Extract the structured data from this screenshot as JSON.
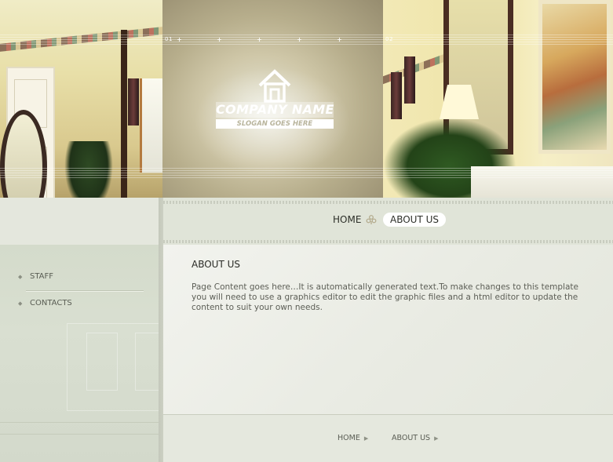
{
  "header": {
    "company_name": "COMPANY NAME",
    "slogan": "SLOGAN GOES HERE",
    "photo_labels": [
      "01",
      "02"
    ]
  },
  "top_nav": {
    "items": [
      {
        "label": "HOME"
      },
      {
        "label": "ABOUT US"
      }
    ]
  },
  "side_nav": {
    "items": [
      {
        "label": "STAFF"
      },
      {
        "label": "CONTACTS"
      }
    ]
  },
  "content": {
    "title": "ABOUT US",
    "body": "Page Content goes here…It is automatically generated text.To make changes to this template you will need to use a graphics editor to edit the graphic files and a html editor to update the content to suit your own needs."
  },
  "footer": {
    "links": [
      {
        "label": "HOME"
      },
      {
        "label": "ABOUT US"
      }
    ]
  },
  "colors": {
    "page_bg": "#e4e7dd",
    "sidebar_bg": "#d9dfd1",
    "text_dark": "#2a2b26",
    "text_muted": "#5c5e56",
    "active_tab_bg": "#ffffff"
  },
  "icons": [
    "house-logo-icon",
    "fleur-separator-icon",
    "bullet-icon",
    "arrow-right-icon"
  ]
}
